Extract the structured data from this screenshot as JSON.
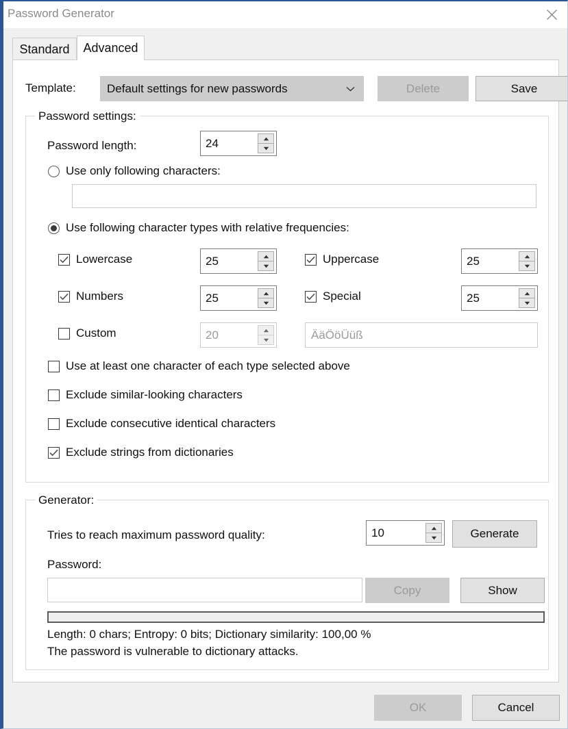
{
  "window": {
    "title": "Password Generator",
    "close_icon": "close-icon"
  },
  "tabs": [
    {
      "label": "Standard",
      "active": false
    },
    {
      "label": "Advanced",
      "active": true
    }
  ],
  "template": {
    "label": "Template:",
    "selected": "Default settings for new passwords",
    "dropdown_icon": "chevron-down-icon",
    "delete_label": "Delete",
    "delete_enabled": false,
    "save_label": "Save",
    "save_enabled": true
  },
  "password_settings": {
    "title": "Password settings:",
    "length_label": "Password length:",
    "length_value": "24",
    "mode_only_chars": {
      "label": "Use only following characters:",
      "selected": false,
      "field_value": "",
      "field_placeholder": ""
    },
    "mode_char_types": {
      "label": "Use following character types with relative frequencies:",
      "selected": true
    },
    "char_types": [
      {
        "name": "Lowercase",
        "checked": true,
        "weight": "25",
        "enabled": true
      },
      {
        "name": "Uppercase",
        "checked": true,
        "weight": "25",
        "enabled": true
      },
      {
        "name": "Numbers",
        "checked": true,
        "weight": "25",
        "enabled": true
      },
      {
        "name": "Special",
        "checked": true,
        "weight": "25",
        "enabled": true
      },
      {
        "name": "Custom",
        "checked": false,
        "weight": "20",
        "enabled": false
      }
    ],
    "custom_chars_placeholder": "ÄäÖöÜüß",
    "options": [
      {
        "label": "Use at least one character of each type selected above",
        "checked": false
      },
      {
        "label": "Exclude similar-looking characters",
        "checked": false
      },
      {
        "label": "Exclude consecutive identical characters",
        "checked": false
      },
      {
        "label": "Exclude strings from dictionaries",
        "checked": true
      }
    ]
  },
  "generator": {
    "title": "Generator:",
    "tries_label": "Tries to reach maximum password quality:",
    "tries_value": "10",
    "generate_label": "Generate",
    "password_label": "Password:",
    "password_value": "",
    "copy_label": "Copy",
    "copy_enabled": false,
    "show_label": "Show",
    "quality_percent": 0,
    "stat_line1": "Length: 0 chars; Entropy: 0 bits; Dictionary similarity: 100,00 %",
    "stat_line2": "The password is vulnerable to dictionary attacks."
  },
  "footer": {
    "ok_label": "OK",
    "ok_enabled": false,
    "cancel_label": "Cancel"
  },
  "colors": {
    "window_border": "#2b579a",
    "panel_bg": "#f0f0f0",
    "content_bg": "#ffffff",
    "button_bg": "#e1e1e1",
    "button_disabled_bg": "#cccccc",
    "text": "#101010",
    "text_disabled": "#9a9a9a"
  }
}
